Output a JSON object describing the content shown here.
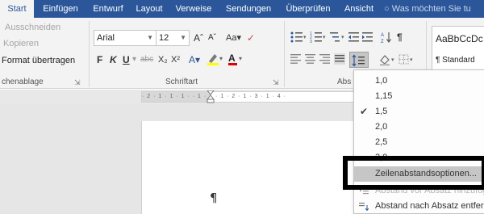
{
  "tabs": [
    {
      "label": "Start",
      "active": true
    },
    {
      "label": "Einfügen"
    },
    {
      "label": "Entwurf"
    },
    {
      "label": "Layout"
    },
    {
      "label": "Verweise"
    },
    {
      "label": "Sendungen"
    },
    {
      "label": "Überprüfen"
    },
    {
      "label": "Ansicht"
    }
  ],
  "tell_me": "Was möchten Sie tu",
  "clipboard": {
    "cut": "Ausschneiden",
    "copy": "Kopieren",
    "format_painter": "Format übertragen",
    "group_label": "chenablage"
  },
  "font": {
    "name": "Arial",
    "size": "12",
    "group_label": "Schriftart"
  },
  "paragraph": {
    "group_label": "Abs"
  },
  "styles": {
    "preview": "AaBbCcDc",
    "name": "¶ Standard"
  },
  "ruler": {
    "ticks": "· 2 · 1 · 1 · 1 ·   · 1 · 1 · 1 · 2 · 1 · 3 · 1 · 4 ·"
  },
  "document": {
    "pilcrow": "¶"
  },
  "line_spacing_menu": {
    "items": [
      {
        "label": "1,0"
      },
      {
        "label": "1,15"
      },
      {
        "label": "1,5",
        "checked": true
      },
      {
        "label": "2,0"
      },
      {
        "label": "2,5"
      },
      {
        "label": "3,0"
      }
    ],
    "options_label": "Zeilenabstandsoptionen...",
    "space_before": "Abstand vor Absatz hinzufügen",
    "space_after": "Abstand nach Absatz entfernen"
  },
  "colors": {
    "tab_bar": "#2b579a",
    "ribbon": "#f3f3f3",
    "highlight_annotation": "#000000",
    "menu_hover": "#c6c6c6"
  }
}
